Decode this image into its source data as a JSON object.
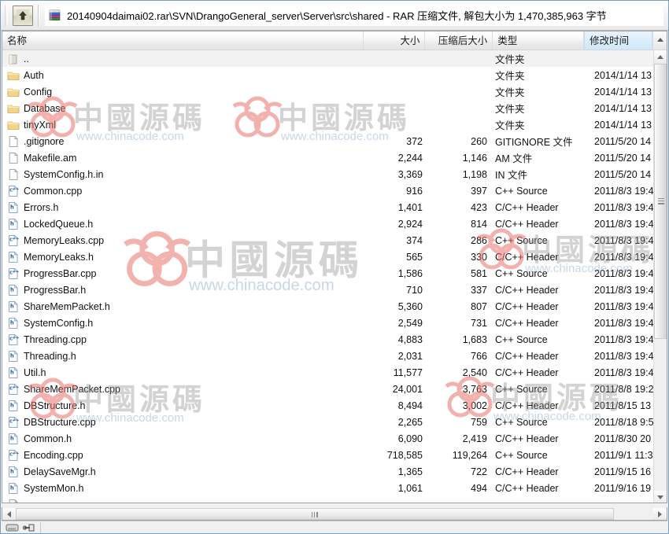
{
  "window": {
    "title": "20140904daimai02.rar\\SVN\\DrangoGeneral_server\\Server\\src\\shared - RAR 压缩文件, 解包大小为 1,470,385,963 字节",
    "up_button_tooltip": "向上一级"
  },
  "columns": {
    "name": "名称",
    "size": "大小",
    "packed": "压缩后大小",
    "type": "类型",
    "modified": "修改时间"
  },
  "rows": [
    {
      "icon": "parent-folder-icon",
      "name": "..",
      "size": "",
      "packed": "",
      "type": "文件夹",
      "modified": ""
    },
    {
      "icon": "folder-icon",
      "name": "Auth",
      "size": "",
      "packed": "",
      "type": "文件夹",
      "modified": "2014/1/14 13"
    },
    {
      "icon": "folder-icon",
      "name": "Config",
      "size": "",
      "packed": "",
      "type": "文件夹",
      "modified": "2014/1/14 13"
    },
    {
      "icon": "folder-icon",
      "name": "Database",
      "size": "",
      "packed": "",
      "type": "文件夹",
      "modified": "2014/1/14 13"
    },
    {
      "icon": "folder-icon",
      "name": "tinyXml",
      "size": "",
      "packed": "",
      "type": "文件夹",
      "modified": "2014/1/14 13"
    },
    {
      "icon": "blank-file-icon",
      "name": ".gitignore",
      "size": "372",
      "packed": "260",
      "type": "GITIGNORE 文件",
      "modified": "2011/5/20 14"
    },
    {
      "icon": "blank-file-icon",
      "name": "Makefile.am",
      "size": "2,244",
      "packed": "1,146",
      "type": "AM 文件",
      "modified": "2011/5/20 14"
    },
    {
      "icon": "blank-file-icon",
      "name": "SystemConfig.h.in",
      "size": "3,369",
      "packed": "1,198",
      "type": "IN 文件",
      "modified": "2011/5/20 14"
    },
    {
      "icon": "cpp-source-icon",
      "name": "Common.cpp",
      "size": "916",
      "packed": "397",
      "type": "C++ Source",
      "modified": "2011/8/3 19:4"
    },
    {
      "icon": "h-header-icon",
      "name": "Errors.h",
      "size": "1,401",
      "packed": "423",
      "type": "C/C++ Header",
      "modified": "2011/8/3 19:4"
    },
    {
      "icon": "h-header-icon",
      "name": "LockedQueue.h",
      "size": "2,924",
      "packed": "814",
      "type": "C/C++ Header",
      "modified": "2011/8/3 19:4"
    },
    {
      "icon": "cpp-source-icon",
      "name": "MemoryLeaks.cpp",
      "size": "374",
      "packed": "286",
      "type": "C++ Source",
      "modified": "2011/8/3 19:4"
    },
    {
      "icon": "h-header-icon",
      "name": "MemoryLeaks.h",
      "size": "565",
      "packed": "330",
      "type": "C/C++ Header",
      "modified": "2011/8/3 19:4"
    },
    {
      "icon": "cpp-source-icon",
      "name": "ProgressBar.cpp",
      "size": "1,586",
      "packed": "581",
      "type": "C++ Source",
      "modified": "2011/8/3 19:4"
    },
    {
      "icon": "h-header-icon",
      "name": "ProgressBar.h",
      "size": "710",
      "packed": "337",
      "type": "C/C++ Header",
      "modified": "2011/8/3 19:4"
    },
    {
      "icon": "h-header-icon",
      "name": "ShareMemPacket.h",
      "size": "5,360",
      "packed": "807",
      "type": "C/C++ Header",
      "modified": "2011/8/3 19:4"
    },
    {
      "icon": "h-header-icon",
      "name": "SystemConfig.h",
      "size": "2,549",
      "packed": "731",
      "type": "C/C++ Header",
      "modified": "2011/8/3 19:4"
    },
    {
      "icon": "cpp-source-icon",
      "name": "Threading.cpp",
      "size": "4,883",
      "packed": "1,683",
      "type": "C++ Source",
      "modified": "2011/8/3 19:4"
    },
    {
      "icon": "h-header-icon",
      "name": "Threading.h",
      "size": "2,031",
      "packed": "766",
      "type": "C/C++ Header",
      "modified": "2011/8/3 19:4"
    },
    {
      "icon": "h-header-icon",
      "name": "Util.h",
      "size": "11,577",
      "packed": "2,540",
      "type": "C/C++ Header",
      "modified": "2011/8/3 19:4"
    },
    {
      "icon": "cpp-source-icon",
      "name": "ShareMemPacket.cpp",
      "size": "24,001",
      "packed": "3,763",
      "type": "C++ Source",
      "modified": "2011/8/8 19:2"
    },
    {
      "icon": "h-header-icon",
      "name": "DBStructure.h",
      "size": "8,494",
      "packed": "3,002",
      "type": "C/C++ Header",
      "modified": "2011/8/15 13"
    },
    {
      "icon": "cpp-source-icon",
      "name": "DBStructure.cpp",
      "size": "2,265",
      "packed": "759",
      "type": "C++ Source",
      "modified": "2011/8/18 9:5"
    },
    {
      "icon": "h-header-icon",
      "name": "Common.h",
      "size": "6,090",
      "packed": "2,419",
      "type": "C/C++ Header",
      "modified": "2011/8/30 20"
    },
    {
      "icon": "cpp-source-icon",
      "name": "Encoding.cpp",
      "size": "718,585",
      "packed": "119,264",
      "type": "C++ Source",
      "modified": "2011/9/1 11:3"
    },
    {
      "icon": "h-header-icon",
      "name": "DelaySaveMgr.h",
      "size": "1,365",
      "packed": "722",
      "type": "C/C++ Header",
      "modified": "2011/9/15 16"
    },
    {
      "icon": "h-header-icon",
      "name": "SystemMon.h",
      "size": "1,061",
      "packed": "494",
      "type": "C/C++ Header",
      "modified": "2011/9/16 19"
    }
  ],
  "watermarks": [
    {
      "cn": "中國源碼",
      "url": "www.chinacode.com"
    },
    {
      "cn": "中國源碼",
      "url": "www.chinacode.com"
    },
    {
      "cn": "中國源碼",
      "url": "www.chinacode.com"
    },
    {
      "cn": "中國源碼",
      "url": "www.chinacode.com"
    },
    {
      "cn": "中國源碼",
      "url": "www.chinacode.com"
    },
    {
      "cn": "中國源碼",
      "url": "www.chinacode.com"
    }
  ],
  "status": {
    "text": ""
  },
  "colors": {
    "sorted_header": "#d8ecfa",
    "window_border": "#7d9cc0",
    "watermark_red": "#e8736b",
    "watermark_gray": "#969696"
  }
}
